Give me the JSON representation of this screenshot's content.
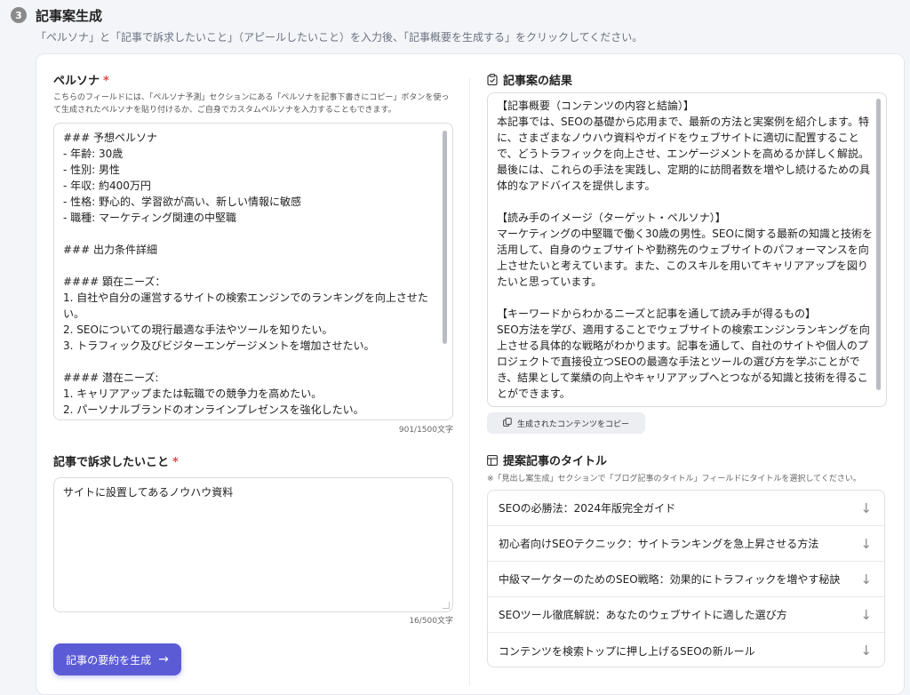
{
  "step": {
    "number": "3",
    "title": "記事案生成",
    "description": "「ペルソナ」と「記事で訴求したいこと」（アピールしたいこと）を入力後、「記事概要を生成する」をクリックしてください。"
  },
  "persona": {
    "label": "ペルソナ",
    "required_mark": "*",
    "help": "こちらのフィールドには、「ペルソナ予測」セクションにある「ペルソナを記事下書きにコピー」ボタンを使って生成されたペルソナを貼り付けるか、ご自身でカスタムペルソナを入力することもできます。",
    "value": "### 予想ペルソナ\n- 年齢: 30歳\n- 性別: 男性\n- 年収: 約400万円\n- 性格: 野心的、学習欲が高い、新しい情報に敏感\n- 職種: マーケティング関連の中堅職\n\n### 出力条件詳細\n\n#### 顕在ニーズ：\n1. 自社や自分の運営するサイトの検索エンジンでのランキングを向上させたい。\n2. SEOについての現行最適な手法やツールを知りたい。\n3. トラフィック及びビジターエンゲージメントを増加させたい。\n\n#### 潜在ニーズ:\n1. キャリアアップまたは転職での競争力を高めたい。\n2. パーソナルブランドのオンラインプレゼンスを強化したい。",
    "counter": "901/1500文字"
  },
  "appeal": {
    "label": "記事で訴求したいこと",
    "required_mark": "*",
    "value": "サイトに設置してあるノウハウ資料",
    "counter": "16/500文字"
  },
  "generate_button": {
    "label": "記事の要約を生成",
    "icon": "arrow-right-icon"
  },
  "result": {
    "title": "記事案の結果",
    "icon": "clipboard-check-icon",
    "text": "【記事概要（コンテンツの内容と結論）】\n本記事では、SEOの基礎から応用まで、最新の方法と実案例を紹介します。特に、さまざまなノウハウ資料やガイドをウェブサイトに適切に配置することで、どうトラフィックを向上させ、エンゲージメントを高めるか詳しく解説。最後には、これらの手法を実践し、定期的に訪問者数を増やし続けるための具体的なアドバイスを提供します。\n\n【読み手のイメージ（ターゲット・ペルソナ）】\nマーケティングの中堅職で働く30歳の男性。SEOに関する最新の知識と技術を活用して、自身のウェブサイトや勤務先のウェブサイトのパフォーマンスを向上させたいと考えています。また、このスキルを用いてキャリアアップを図りたいと思っています。\n\n【キーワードからわかるニーズと記事を通して読み手が得るもの】\nSEO方法を学び、適用することでウェブサイトの検索エンジンランキングを向上させる具体的な戦略がわかります。記事を通して、自社のサイトや個人のプロジェクトで直接役立つSEOの最適な手法とツールの選び方を学ぶことができ、結果として業績の向上やキャリアアップへとつながる知識と技術を得ることができます。",
    "copy_button": "生成されたコンテンツをコピー"
  },
  "titles": {
    "title": "提案記事のタイトル",
    "icon": "table-icon",
    "note": "※「見出し案生成」セクションで「ブログ記事のタイトル」フィールドにタイトルを選択してください。",
    "items": [
      "SEOの必勝法：2024年版完全ガイド",
      "初心者向けSEOテクニック：サイトランキングを急上昇させる方法",
      "中級マーケターのためのSEO戦略：効果的にトラフィックを増やす秘訣",
      "SEOツール徹底解説：あなたのウェブサイトに適した選び方",
      "コンテンツを検索トップに押し上げるSEOの新ルール"
    ],
    "item_icon": "arrow-down-icon"
  }
}
